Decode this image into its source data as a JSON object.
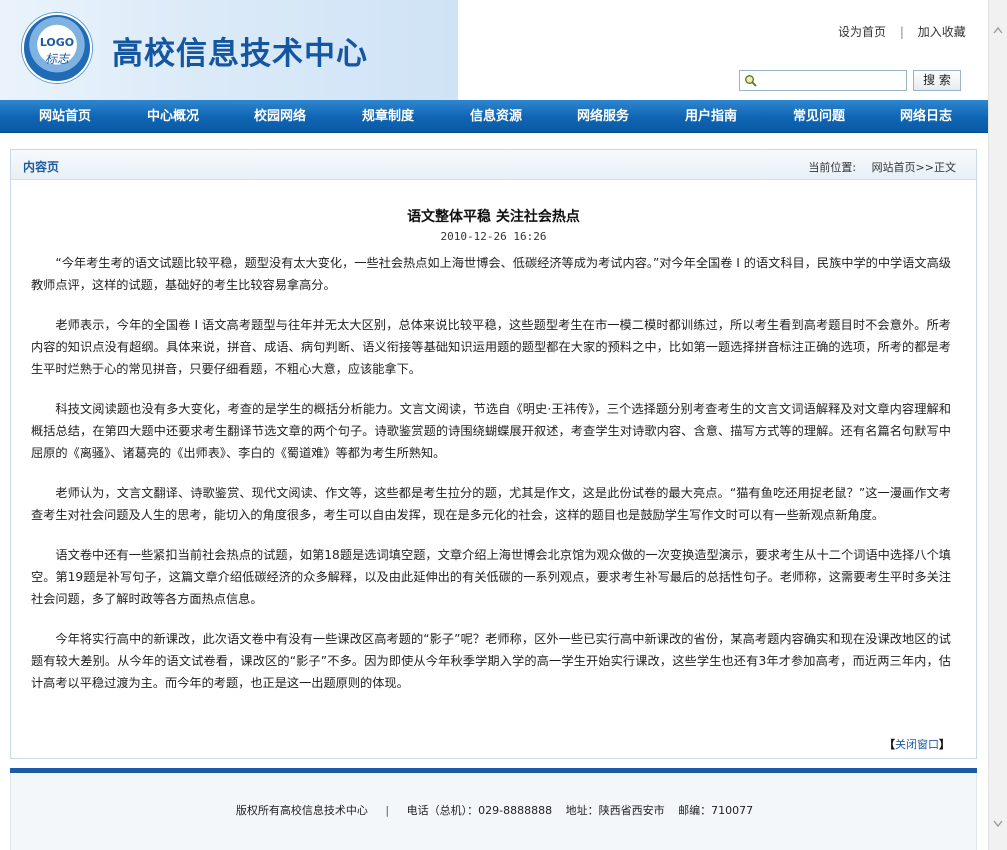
{
  "header": {
    "logo_text": "LOGO",
    "logo_sub": "标志",
    "site_title": "高校信息技术中心",
    "set_home": "设为首页",
    "sep": "|",
    "add_fav": "加入收藏",
    "search_placeholder": "",
    "search_button": "搜 索"
  },
  "nav": {
    "items": [
      {
        "label": "网站首页"
      },
      {
        "label": "中心概况"
      },
      {
        "label": "校园网络"
      },
      {
        "label": "规章制度"
      },
      {
        "label": "信息资源"
      },
      {
        "label": "网络服务"
      },
      {
        "label": "用户指南"
      },
      {
        "label": "常见问题"
      },
      {
        "label": "网络日志"
      }
    ]
  },
  "content": {
    "panel_label": "内容页",
    "breadcrumb_label": "当前位置:",
    "breadcrumb_path": "网站首页>>正文",
    "title": "语文整体平稳 关注社会热点",
    "date": "2010-12-26 16:26",
    "paragraphs": [
      "“今年考生考的语文试题比较平稳，题型没有太大变化，一些社会热点如上海世博会、低碳经济等成为考试内容。”对今年全国卷 I 的语文科目，民族中学的中学语文高级教师点评，这样的试题，基础好的考生比较容易拿高分。",
      "老师表示，今年的全国卷 I 语文高考题型与往年并无太大区别，总体来说比较平稳，这些题型考生在市一模二模时都训练过，所以考生看到高考题目时不会意外。所考内容的知识点没有超纲。具体来说，拼音、成语、病句判断、语义衔接等基础知识运用题的题型都在大家的预料之中，比如第一题选择拼音标注正确的选项，所考的都是考生平时烂熟于心的常见拼音，只要仔细看题，不粗心大意，应该能拿下。",
      "科技文阅读题也没有多大变化，考查的是学生的概括分析能力。文言文阅读，节选自《明史·王祎传》，三个选择题分别考查考生的文言文词语解释及对文章内容理解和概括总结，在第四大题中还要求考生翻译节选文章的两个句子。诗歌鉴赏题的诗围绕蝴蝶展开叙述，考查学生对诗歌内容、含意、描写方式等的理解。还有名篇名句默写中屈原的《离骚》、诸葛亮的《出师表》、李白的《蜀道难》等都为考生所熟知。",
      "老师认为，文言文翻译、诗歌鉴赏、现代文阅读、作文等，这些都是考生拉分的题，尤其是作文，这是此份试卷的最大亮点。“猫有鱼吃还用捉老鼠？”这一漫画作文考查考生对社会问题及人生的思考，能切入的角度很多，考生可以自由发挥，现在是多元化的社会，这样的题目也是鼓励学生写作文时可以有一些新观点新角度。",
      "语文卷中还有一些紧扣当前社会热点的试题，如第18题是选词填空题，文章介绍上海世博会北京馆为观众做的一次变换造型演示，要求考生从十二个词语中选择八个填空。第19题是补写句子，这篇文章介绍低碳经济的众多解释，以及由此延伸出的有关低碳的一系列观点，要求考生补写最后的总括性句子。老师称，这需要考生平时多关注社会问题，多了解时政等各方面热点信息。",
      "今年将实行高中的新课改，此次语文卷中有没有一些课改区高考题的“影子”呢？老师称，区外一些已实行高中新课改的省份，某高考题内容确实和现在没课改地区的试题有较大差别。从今年的语文试卷看，课改区的“影子”不多。因为即使从今年秋季学期入学的高一学生开始实行课改，这些学生也还有3年才参加高考，而近两三年内，估计高考以平稳过渡为主。而今年的考题，也正是这一出题原则的体现。"
    ],
    "close_open": "【",
    "close_label": "关闭窗口",
    "close_close": "】"
  },
  "footer": {
    "copyright": "版权所有高校信息技术中心",
    "sep": "|",
    "phone": "电话（总机）：029-8888888",
    "address": "地址：陕西省西安市",
    "postcode": "邮编：710077"
  },
  "colors": {
    "nav_bg": "#0f65b3",
    "title_blue": "#1456a0",
    "link_blue": "#1d5aa0",
    "footer_bar": "#1a5aa6"
  },
  "icons": {
    "search": "search-icon",
    "scroll_up": "chevron-up-icon",
    "scroll_down": "chevron-down-icon"
  }
}
